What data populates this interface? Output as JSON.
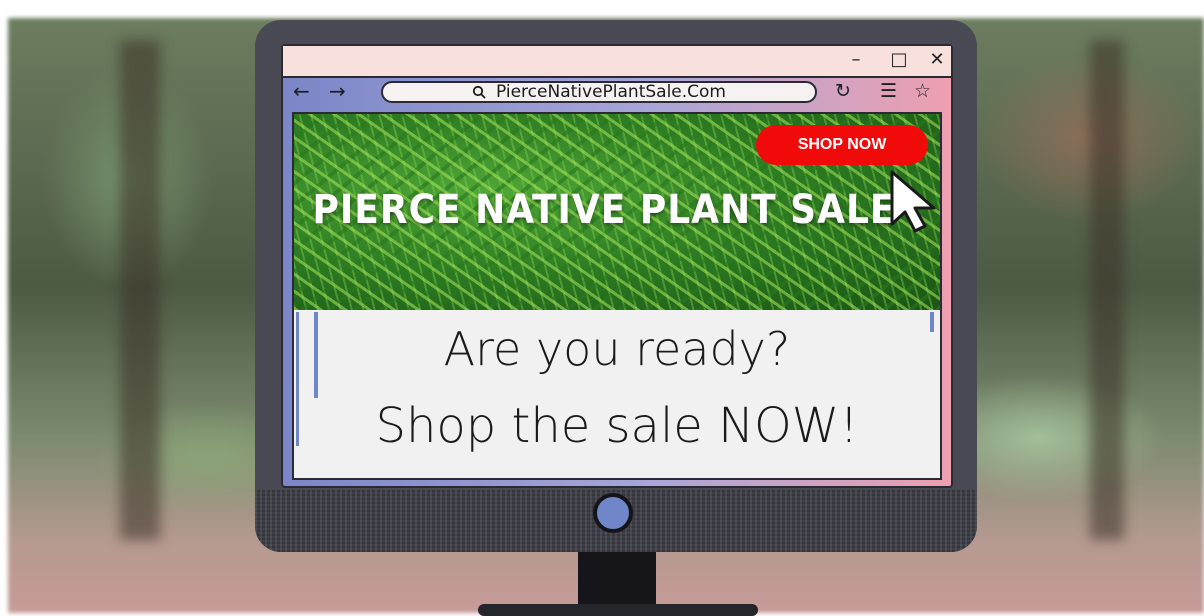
{
  "browser": {
    "url": "PierceNativePlantSale.Com",
    "icons": {
      "back": "arrow-left-icon",
      "forward": "arrow-right-icon",
      "search": "search-icon",
      "reload": "reload-icon",
      "menu": "hamburger-menu-icon",
      "bookmark": "star-icon",
      "minimize": "minimize-icon",
      "maximize": "maximize-icon",
      "close": "close-icon"
    }
  },
  "hero": {
    "title": "PIERCE NATIVE PLANT SALE",
    "cta_label": "SHOP NOW"
  },
  "body": {
    "line1": "Are you ready?",
    "line2": "Shop the sale NOW!"
  },
  "colors": {
    "cta": "#f10a0a",
    "accent_blue": "#6f87c9",
    "titlebar": "#f8e1dd"
  }
}
